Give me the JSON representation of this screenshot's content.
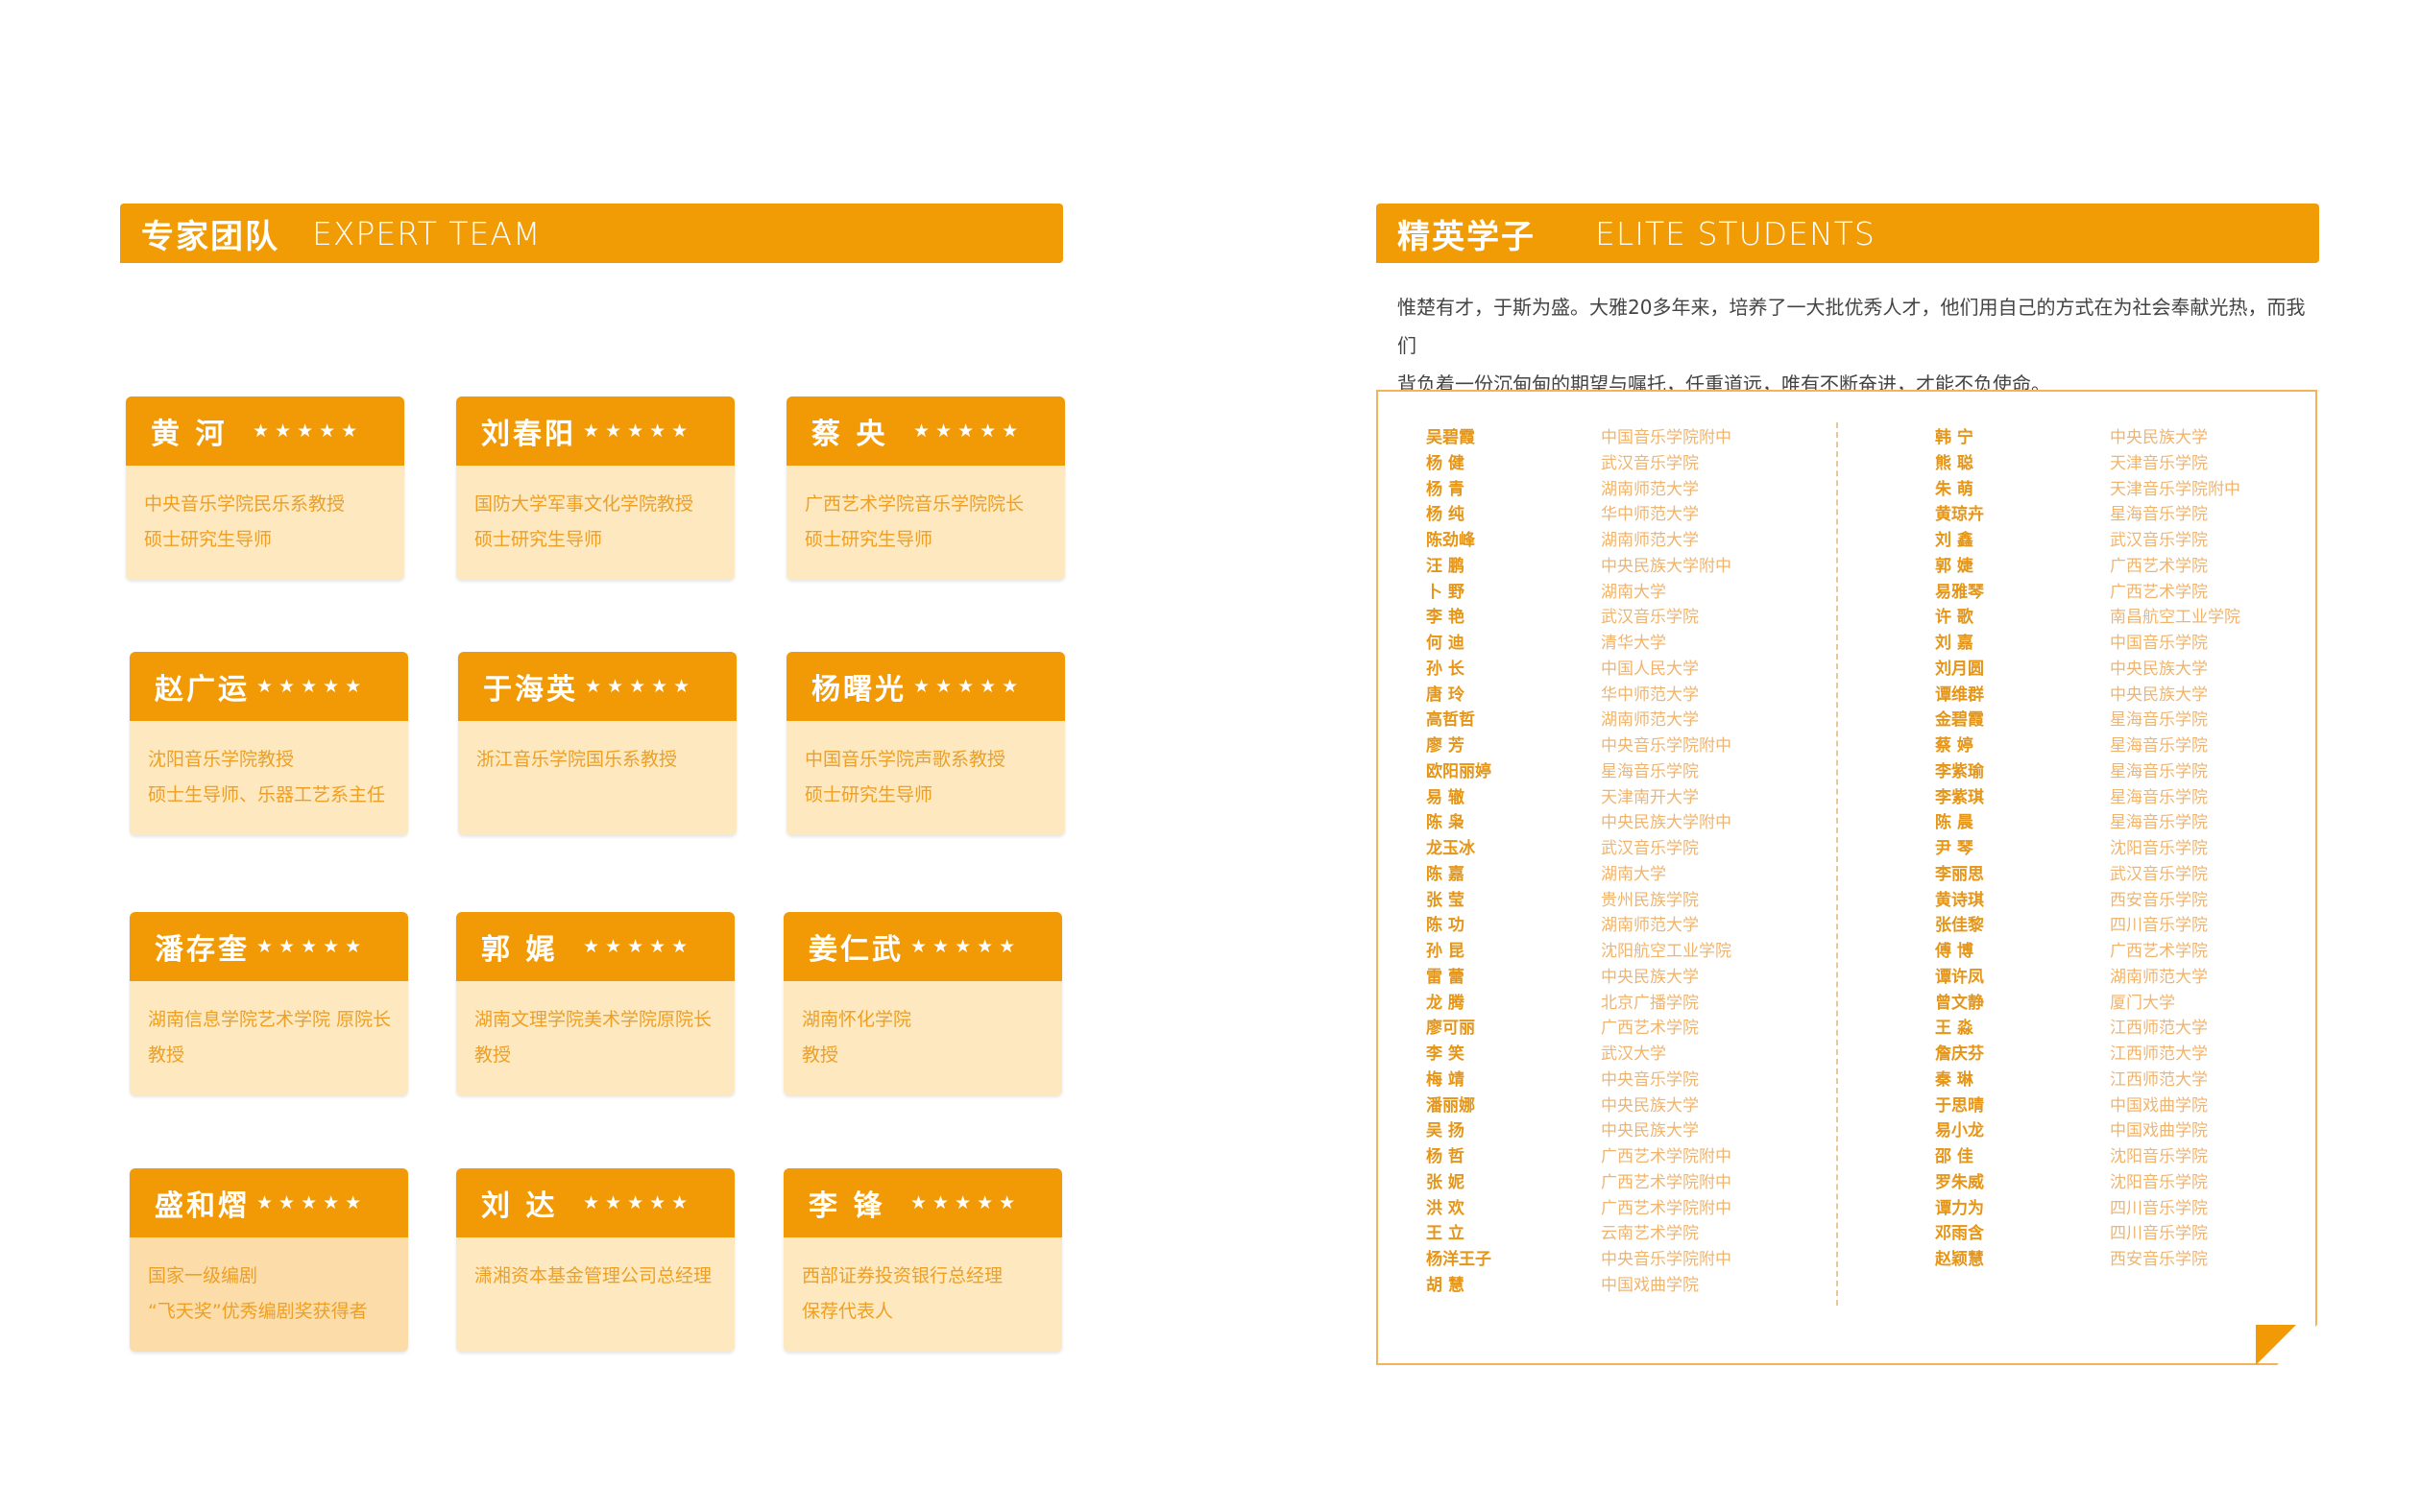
{
  "expert": {
    "title_cn": "专家团队",
    "title_en": "EXPERT TEAM",
    "stars": "★★★★★",
    "cards": [
      {
        "name": "黄 河",
        "lines": [
          "中央音乐学院民乐系教授",
          "硕士研究生导师"
        ]
      },
      {
        "name": "刘春阳",
        "lines": [
          "国防大学军事文化学院教授",
          "硕士研究生导师"
        ]
      },
      {
        "name": "蔡 央",
        "lines": [
          "广西艺术学院音乐学院院长",
          "硕士研究生导师"
        ]
      },
      {
        "name": "赵广运",
        "lines": [
          "沈阳音乐学院教授",
          "硕士生导师、乐器工艺系主任"
        ]
      },
      {
        "name": "于海英",
        "lines": [
          "浙江音乐学院国乐系教授"
        ]
      },
      {
        "name": "杨曙光",
        "lines": [
          "中国音乐学院声歌系教授",
          "硕士研究生导师"
        ]
      },
      {
        "name": "潘存奎",
        "lines": [
          "湖南信息学院艺术学院 原院长",
          "教授"
        ]
      },
      {
        "name": "郭 娓",
        "lines": [
          "湖南文理学院美术学院原院长",
          "教授"
        ]
      },
      {
        "name": "姜仁武",
        "lines": [
          "湖南怀化学院",
          "教授"
        ]
      },
      {
        "name": "盛和熠",
        "lines": [
          "国家一级编剧",
          "“飞天奖”优秀编剧奖获得者"
        ]
      },
      {
        "name": "刘  达",
        "lines": [
          "潇湘资本基金管理公司总经理"
        ]
      },
      {
        "name": "李  锋",
        "lines": [
          "西部证券投资银行总经理",
          "保荐代表人"
        ]
      }
    ]
  },
  "elite": {
    "title_cn": "精英学子",
    "title_en": "ELITE STUDENTS",
    "intro_line1": "惟楚有才，于斯为盛。大雅20多年来，培养了一大批优秀人才，他们用自己的方式在为社会奉献光热，而我们",
    "intro_line2": "背负着一份沉甸甸的期望与嘱托，任重道远，唯有不断奋进，才能不负使命。",
    "left_column": [
      {
        "name": "吴碧霞",
        "school": "中国音乐学院附中"
      },
      {
        "name": "杨 健",
        "school": "武汉音乐学院"
      },
      {
        "name": "杨 青",
        "school": "湖南师范大学"
      },
      {
        "name": "杨 纯",
        "school": "华中师范大学"
      },
      {
        "name": "陈劲峰",
        "school": "湖南师范大学"
      },
      {
        "name": "汪 鹏",
        "school": "中央民族大学附中"
      },
      {
        "name": "卜 野",
        "school": "湖南大学"
      },
      {
        "name": "李 艳",
        "school": "武汉音乐学院"
      },
      {
        "name": "何 迪",
        "school": "清华大学"
      },
      {
        "name": "孙 长",
        "school": "中国人民大学"
      },
      {
        "name": "唐 玲",
        "school": "华中师范大学"
      },
      {
        "name": "高哲哲",
        "school": "湖南师范大学"
      },
      {
        "name": "廖 芳",
        "school": "中央音乐学院附中"
      },
      {
        "name": "欧阳丽婷",
        "school": "星海音乐学院"
      },
      {
        "name": "易 辙",
        "school": "天津南开大学"
      },
      {
        "name": "陈 枭",
        "school": "中央民族大学附中"
      },
      {
        "name": "龙玉冰",
        "school": "武汉音乐学院"
      },
      {
        "name": "陈 嘉",
        "school": "湖南大学"
      },
      {
        "name": "张 莹",
        "school": "贵州民族学院"
      },
      {
        "name": "陈 功",
        "school": "湖南师范大学"
      },
      {
        "name": "孙 昆",
        "school": "沈阳航空工业学院"
      },
      {
        "name": "雷 蕾",
        "school": "中央民族大学"
      },
      {
        "name": "龙 腾",
        "school": "北京广播学院"
      },
      {
        "name": "廖可丽",
        "school": "广西艺术学院"
      },
      {
        "name": "李 笑",
        "school": "武汉大学"
      },
      {
        "name": "梅 靖",
        "school": "中央音乐学院"
      },
      {
        "name": "潘丽娜",
        "school": "中央民族大学"
      },
      {
        "name": "吴 扬",
        "school": "中央民族大学"
      },
      {
        "name": "杨 哲",
        "school": "广西艺术学院附中"
      },
      {
        "name": "张 妮",
        "school": "广西艺术学院附中"
      },
      {
        "name": "洪 欢",
        "school": "广西艺术学院附中"
      },
      {
        "name": "王 立",
        "school": "云南艺术学院"
      },
      {
        "name": "杨洋王子",
        "school": "中央音乐学院附中"
      },
      {
        "name": "胡 慧",
        "school": "中国戏曲学院"
      }
    ],
    "right_column": [
      {
        "name": "韩 宁",
        "school": "中央民族大学"
      },
      {
        "name": "熊 聪",
        "school": "天津音乐学院"
      },
      {
        "name": "朱 萌",
        "school": "天津音乐学院附中"
      },
      {
        "name": "黄琼卉",
        "school": "星海音乐学院"
      },
      {
        "name": "刘 鑫",
        "school": "武汉音乐学院"
      },
      {
        "name": "郭 婕",
        "school": "广西艺术学院"
      },
      {
        "name": "易雅琴",
        "school": "广西艺术学院"
      },
      {
        "name": "许 歌",
        "school": "南昌航空工业学院"
      },
      {
        "name": "刘 嘉",
        "school": "中国音乐学院"
      },
      {
        "name": "刘月圆",
        "school": "中央民族大学"
      },
      {
        "name": "谭维群",
        "school": "中央民族大学"
      },
      {
        "name": "金碧霞",
        "school": "星海音乐学院"
      },
      {
        "name": "蔡 婷",
        "school": "星海音乐学院"
      },
      {
        "name": "李紫瑜",
        "school": "星海音乐学院"
      },
      {
        "name": "李紫琪",
        "school": "星海音乐学院"
      },
      {
        "name": "陈 晨",
        "school": "星海音乐学院"
      },
      {
        "name": "尹 琴",
        "school": "沈阳音乐学院"
      },
      {
        "name": "李丽思",
        "school": "武汉音乐学院"
      },
      {
        "name": "黄诗琪",
        "school": "西安音乐学院"
      },
      {
        "name": "张佳黎",
        "school": "四川音乐学院"
      },
      {
        "name": "傅 博",
        "school": "广西艺术学院"
      },
      {
        "name": "谭许凤",
        "school": "湖南师范大学"
      },
      {
        "name": "曾文静",
        "school": "厦门大学"
      },
      {
        "name": "王 淼",
        "school": "江西师范大学"
      },
      {
        "name": "詹庆芬",
        "school": "江西师范大学"
      },
      {
        "name": "秦 琳",
        "school": "江西师范大学"
      },
      {
        "name": "于思晴",
        "school": "中国戏曲学院"
      },
      {
        "name": "易小龙",
        "school": "中国戏曲学院"
      },
      {
        "name": "邵 佳",
        "school": "沈阳音乐学院"
      },
      {
        "name": "罗朱威",
        "school": "沈阳音乐学院"
      },
      {
        "name": "谭力为",
        "school": "四川音乐学院"
      },
      {
        "name": "邓雨含",
        "school": "四川音乐学院"
      },
      {
        "name": "赵颖慧",
        "school": "西安音乐学院"
      }
    ]
  },
  "colors": {
    "accent": "#F29A05",
    "card_bg": "#FDE8BF",
    "name_text": "#E59517",
    "school_text": "#F1B46E"
  }
}
